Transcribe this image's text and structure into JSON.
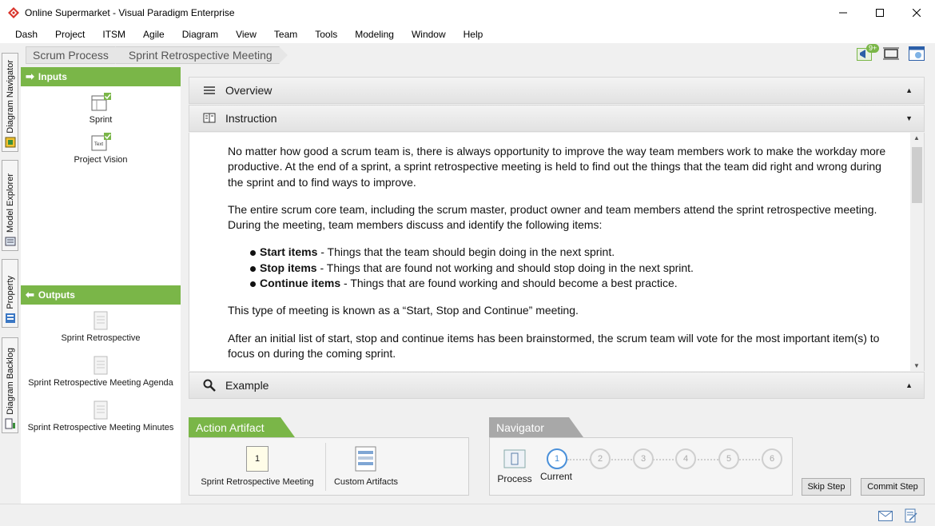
{
  "window": {
    "title": "Online Supermarket - Visual Paradigm Enterprise",
    "minimize_icon": "minimize-icon",
    "maximize_icon": "maximize-icon",
    "close_icon": "close-icon"
  },
  "menu": [
    "Dash",
    "Project",
    "ITSM",
    "Agile",
    "Diagram",
    "View",
    "Team",
    "Tools",
    "Modeling",
    "Window",
    "Help"
  ],
  "side_tabs": [
    "Diagram Navigator",
    "Model Explorer",
    "Property",
    "Diagram Backlog"
  ],
  "breadcrumb": [
    "Scrum Process",
    "Sprint Retrospective Meeting"
  ],
  "notification_badge": "9+",
  "inputs": {
    "title": "Inputs",
    "items": [
      "Sprint",
      "Project Vision"
    ]
  },
  "outputs": {
    "title": "Outputs",
    "items": [
      "Sprint Retrospective",
      "Sprint Retrospective Meeting Agenda",
      "Sprint Retrospective Meeting Minutes"
    ]
  },
  "sections": {
    "overview": "Overview",
    "instruction": "Instruction",
    "example": "Example"
  },
  "instruction": {
    "p1": "No matter how good a scrum team is, there is always opportunity to improve the way team members work to make the workday more productive. At the end of a sprint, a sprint retrospective meeting is held to find out the things that the team did right and wrong during the sprint and to find ways to improve.",
    "p2": "The entire scrum core team, including the scrum master, product owner and team members attend the sprint retrospective meeting. During the meeting, team members discuss and identify the following items:",
    "bullets": [
      {
        "term": "Start items",
        "text": " - Things that the team should begin doing in the next sprint."
      },
      {
        "term": "Stop items",
        "text": " - Things that are found not working and should stop doing in the next sprint."
      },
      {
        "term": "Continue items",
        "text": " - Things that are found working and should become a best practice."
      }
    ],
    "p3": "This type of meeting is known as a “Start, Stop and Continue” meeting.",
    "p4": "After an initial list of start, stop and continue items has been brainstormed, the scrum team will vote for the most important item(s) to focus on during the coming sprint."
  },
  "action_artifact": {
    "title": "Action Artifact",
    "items": [
      {
        "label": "Sprint Retrospective Meeting",
        "badge": "1"
      },
      {
        "label": "Custom Artifacts"
      }
    ]
  },
  "navigator": {
    "title": "Navigator",
    "process_label": "Process",
    "current_label": "Current",
    "steps": [
      "1",
      "2",
      "3",
      "4",
      "5",
      "6"
    ],
    "current_step": 1
  },
  "buttons": {
    "skip": "Skip Step",
    "commit": "Commit Step"
  }
}
